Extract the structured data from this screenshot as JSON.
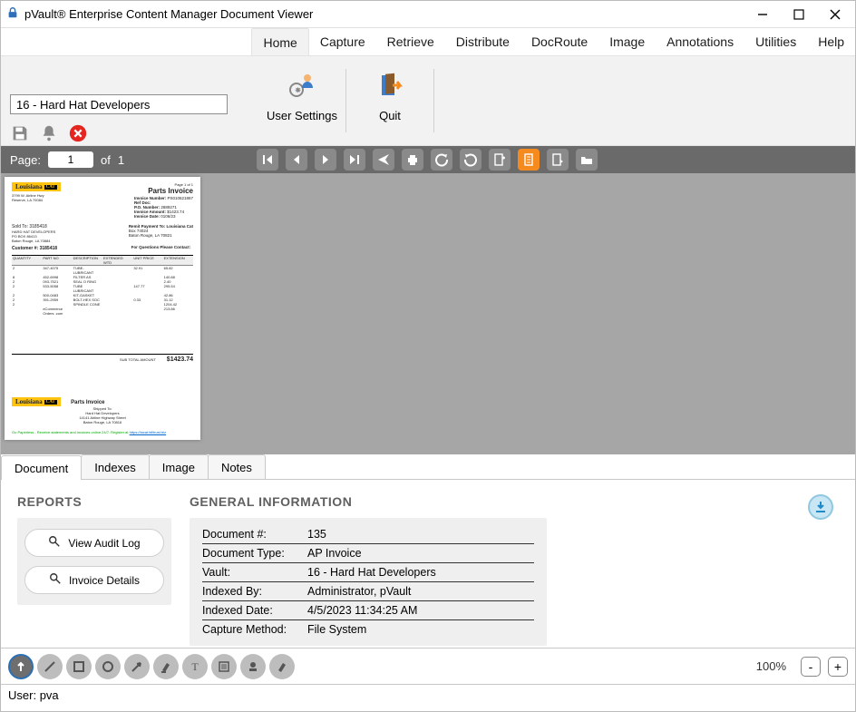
{
  "window": {
    "title": "pVault® Enterprise Content Manager Document Viewer"
  },
  "menu": {
    "items": [
      "Home",
      "Capture",
      "Retrieve",
      "Distribute",
      "DocRoute",
      "Image",
      "Annotations",
      "Utilities",
      "Help"
    ],
    "active_index": 0
  },
  "ribbon": {
    "job_select_value": "16 - Hard Hat Developers",
    "buttons": [
      {
        "label": "User Settings",
        "icon": "user-settings"
      },
      {
        "label": "Quit",
        "icon": "quit"
      }
    ]
  },
  "pagebar": {
    "label": "Page:",
    "current": "1",
    "of_label": "of",
    "total": "1",
    "nav": [
      "first",
      "prev",
      "next",
      "last",
      "send",
      "print",
      "rotate-ccw",
      "rotate-cw",
      "page-add",
      "page-current",
      "page-export",
      "folder"
    ]
  },
  "document_preview": {
    "brand": "Louisiana",
    "brand_box": "CAT",
    "heading": "Parts Invoice",
    "page_label": "Page 1 of 1",
    "fields": {
      "invoice_number_label": "Invoice Number:",
      "invoice_number": "PS010621867",
      "ref_doc_label": "Ref Doc:",
      "po_number_label": "P.O. Number:",
      "po_number": "2889271",
      "invoice_amount_label": "Invoice Amount:",
      "invoice_amount": "$1423.74",
      "invoice_date_label": "Invoice Date:",
      "invoice_date": "0106/23"
    },
    "sold_to": "Sold To: 3185418",
    "sold_to_lines": [
      "HARD HAT DEVELOPERS",
      "PO BOX 86413",
      "Baton Rouge, LA 70884"
    ],
    "customer_label": "Customer #:",
    "customer_no": "3185418",
    "remit_label": "Remit Payment To: Louisiana Cat",
    "remit_lines": [
      "Box 74024",
      "Baton Rouge, LA 70821"
    ],
    "questions_label": "For Questions Please Contact:",
    "table": {
      "headers": [
        "QUANTITY",
        "PART NO",
        "DESCRIPTION",
        "EXTENDED WTD",
        "UNIT PRICE",
        "EXTENSION"
      ],
      "rows": [
        [
          "2",
          "347-4075",
          "TUBE-LUBRICANT",
          "",
          "32.91",
          "65.82"
        ],
        [
          "8",
          "452-6998",
          "FILTER AS",
          "",
          "",
          "140.88"
        ],
        [
          "2",
          "093-7521",
          "SEAL O RING",
          "",
          "",
          "2.40"
        ],
        [
          "2",
          "533-5058",
          "TUBE LUBRICANT",
          "",
          "147.77",
          "295.54"
        ],
        [
          "2",
          "500-0483",
          "KIT-GASKET",
          "",
          "",
          "42.86"
        ],
        [
          "2",
          "391-2959",
          "BOLT-HEX SOC",
          "",
          "0.33",
          "31.12"
        ],
        [
          "2",
          "",
          " SPINDLE CONE",
          "",
          "",
          "1204.42"
        ],
        [
          "",
          "eCommerce Orders .com",
          "",
          "",
          "",
          "213.86"
        ]
      ],
      "total_label": "SUB TOTAL AMOUNT",
      "total": "$1423.74"
    },
    "footer": {
      "brand": "Louisiana",
      "title": "Parts Invoice",
      "shipped_to": "Shipped To:",
      "ship_lines": [
        "Hard Hat Developers",
        "14141 Airline Highway Street",
        "Baton Rouge, LA 70816"
      ],
      "paperless": "Go Paperless - Receive statements and invoices online 24/7. Register at",
      "link": "https://lacat.billtrust.biz"
    }
  },
  "tabs": {
    "items": [
      "Document",
      "Indexes",
      "Image",
      "Notes"
    ],
    "active_index": 0
  },
  "panel": {
    "reports_header": "REPORTS",
    "reports": [
      {
        "label": "View Audit Log"
      },
      {
        "label": "Invoice Details"
      }
    ],
    "general_header": "GENERAL INFORMATION",
    "rows": [
      {
        "k": "Document #:",
        "v": "135"
      },
      {
        "k": "Document Type:",
        "v": "AP Invoice"
      },
      {
        "k": "Vault:",
        "v": "16 - Hard Hat Developers"
      },
      {
        "k": "Indexed By:",
        "v": "Administrator, pVault"
      },
      {
        "k": "Indexed Date:",
        "v": "4/5/2023 11:34:25 AM"
      },
      {
        "k": "Capture Method:",
        "v": "File System"
      }
    ]
  },
  "anno": {
    "tools": [
      "up-arrow",
      "line",
      "rect",
      "circle",
      "arrow",
      "highlight",
      "text",
      "note",
      "stamp",
      "redact"
    ],
    "zoom": "100%"
  },
  "status": {
    "user_label": "User:",
    "user": "pva"
  }
}
